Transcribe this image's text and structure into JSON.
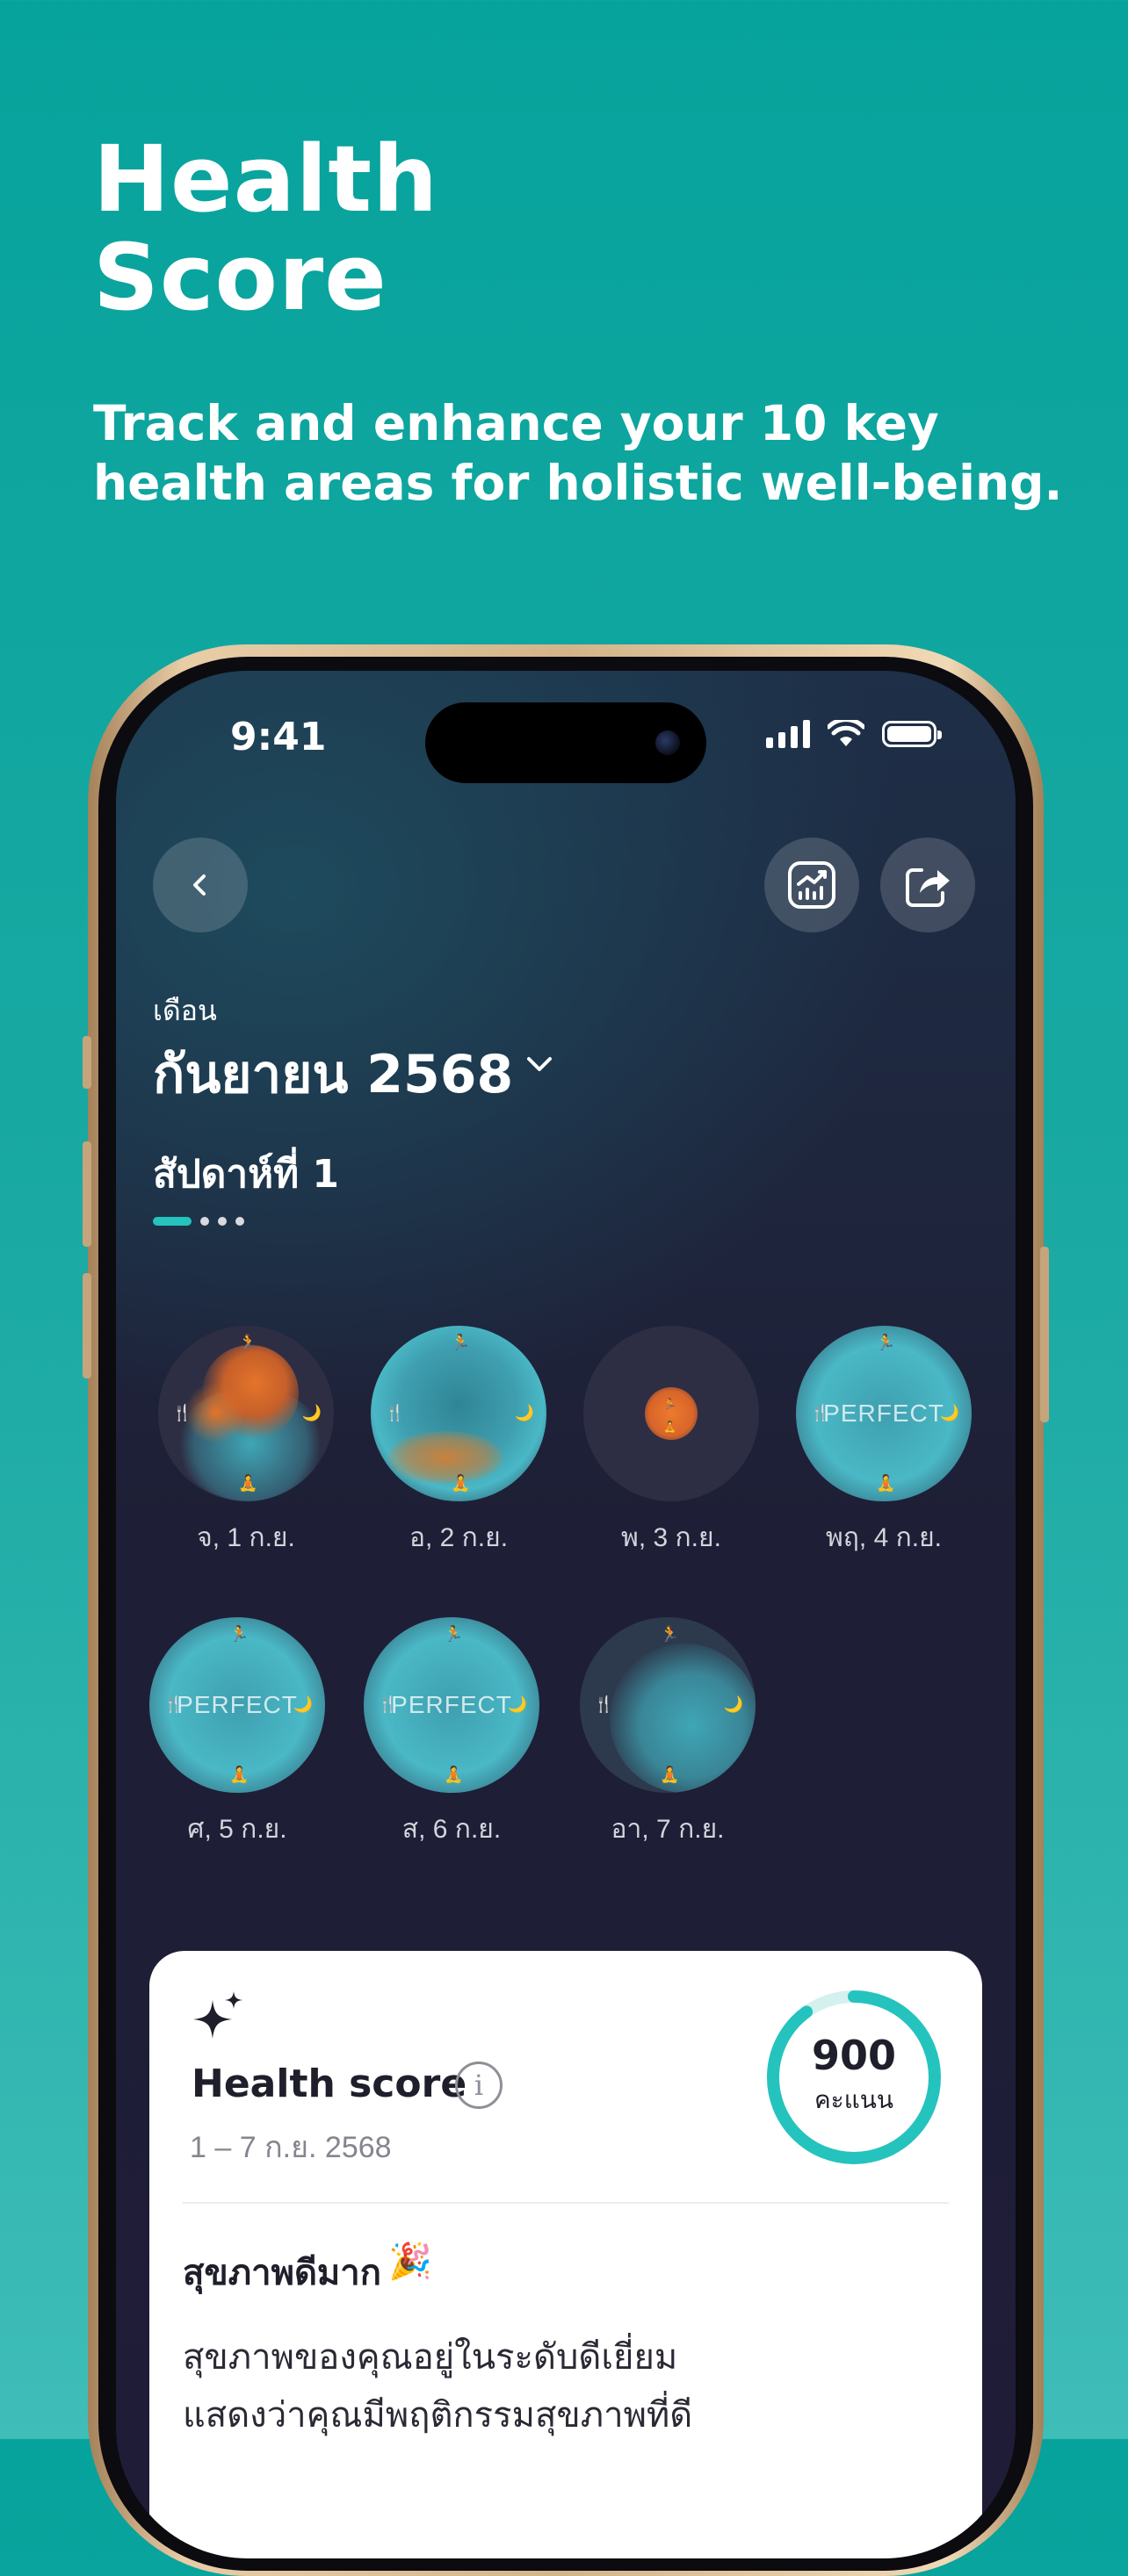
{
  "hero": {
    "title_line1": "Health",
    "title_line2": "Score",
    "subtitle_line1": "Track and enhance your 10 key",
    "subtitle_line2": "health areas for holistic well-being."
  },
  "status_bar": {
    "time": "9:41"
  },
  "header": {
    "back_icon": "chevron-left-icon",
    "trend_icon": "chart-trend-icon",
    "share_icon": "share-icon"
  },
  "month": {
    "label": "เดือน",
    "value": "กันยายน 2568"
  },
  "week": {
    "label": "สัปดาห์ที่ 1"
  },
  "days": [
    {
      "label": "จ, 1 ก.ย.",
      "perfect": ""
    },
    {
      "label": "อ, 2 ก.ย.",
      "perfect": ""
    },
    {
      "label": "พ, 3 ก.ย.",
      "perfect": ""
    },
    {
      "label": "พฤ, 4 ก.ย.",
      "perfect": "PERFECT"
    },
    {
      "label": "ศ, 5 ก.ย.",
      "perfect": "PERFECT"
    },
    {
      "label": "ส, 6 ก.ย.",
      "perfect": "PERFECT"
    },
    {
      "label": "อา, 7 ก.ย.",
      "perfect": ""
    }
  ],
  "bubble_icons": {
    "top": "🏃",
    "left": "🍴",
    "right": "🌙",
    "bottom": "🧘"
  },
  "health_card": {
    "sparkle_icon": "sparkle-icon",
    "title": "Health score",
    "info": "i",
    "range": "1 – 7 ก.ย. 2568",
    "score": "900",
    "score_unit": "คะแนน",
    "score_fraction": 0.9,
    "status": "สุขภาพดีมาก",
    "status_emoji": "🎉",
    "description_line1": "สุขภาพของคุณอยู่ในระดับดีเยี่ยม",
    "description_line2": "แสดงว่าคุณมีพฤติกรรมสุขภาพที่ดี"
  },
  "colors": {
    "background": "#06a39c",
    "accent": "#25c3bd",
    "orange": "#e4742a",
    "bubble_teal": "#4ab8c6"
  }
}
